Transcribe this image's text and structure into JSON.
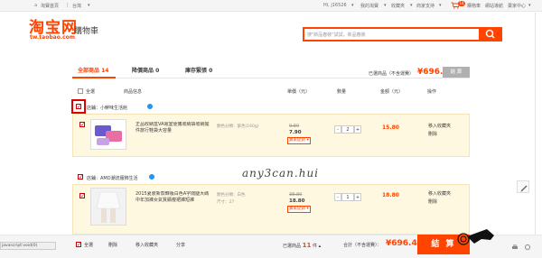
{
  "topbar": {
    "home_label": "淘寶首頁",
    "region_label": "台灣",
    "user_label": "Hi, j16526",
    "my_taobao_label": "我的淘寶",
    "favorites_label": "收藏夾",
    "cart_count": "14",
    "seller_center_label": "賣家中心",
    "cart_label": "購物車",
    "shop_label": "商家支持",
    "help_label": "網站導航"
  },
  "logo": {
    "brand": "淘宝网",
    "url": "tw.taobao.com",
    "subtitle": "購物車"
  },
  "search": {
    "placeholder": "搜\"新品春裝\"試試，新品春裝"
  },
  "tabs": [
    {
      "label": "全部商品",
      "count": "14"
    },
    {
      "label": "降價商品",
      "count": "0"
    },
    {
      "label": "庫存緊張",
      "count": "0"
    }
  ],
  "summary_top": {
    "selected_label": "已選商品（不含運費）",
    "total": "¥696.40",
    "checkout_label": "結 算"
  },
  "columns": {
    "select_all": "全選",
    "product_info": "商品信息",
    "unit_price": "單價（元）",
    "quantity": "數量",
    "subtotal": "金額（元）",
    "actions": "操作"
  },
  "shops": [
    {
      "name": "店鋪：小鮮味生活館",
      "items": [
        {
          "title": "正品收納盒VA電室便攜收納袋收納擺件旅行鞋袋大容量",
          "sku": "顏色分類：紫色(160g)",
          "old_price": "9.80",
          "price": "7.90",
          "promo": "賣家促銷",
          "qty": "2",
          "subtotal": "15.80",
          "op1": "移入收藏夾",
          "op2": "刪除"
        }
      ]
    },
    {
      "name": "店鋪：AMD潮流服飾生活",
      "items": [
        {
          "title": "2015夏裝新款韓版白色A字闊腿大碼中年加褲女氣質顯瘦裙褲短褲",
          "sku": "顏色分類：白色",
          "sku2": "尺寸：27",
          "old_price": "38.80",
          "price": "18.80",
          "promo": "賣家促銷",
          "qty": "1",
          "subtotal": "18.80",
          "op1": "移入收藏夾",
          "op2": "刪除"
        }
      ]
    }
  ],
  "bottom_bar": {
    "select_all": "全選",
    "delete": "刪除",
    "move_fav": "移入收藏夾",
    "share": "分享",
    "selected_prefix": "已選商品",
    "selected_count": "11",
    "selected_suffix": "件",
    "total_label": "合計（不含運費）：",
    "total": "¥696.40",
    "pay_label": "結 算"
  },
  "status": {
    "text": "javascript:void(0)"
  },
  "watermark": {
    "text": "any3can.hui"
  },
  "colors": {
    "accent": "#ff4400",
    "item_bg": "#fff8e1",
    "selected_border": "#cc0000"
  }
}
